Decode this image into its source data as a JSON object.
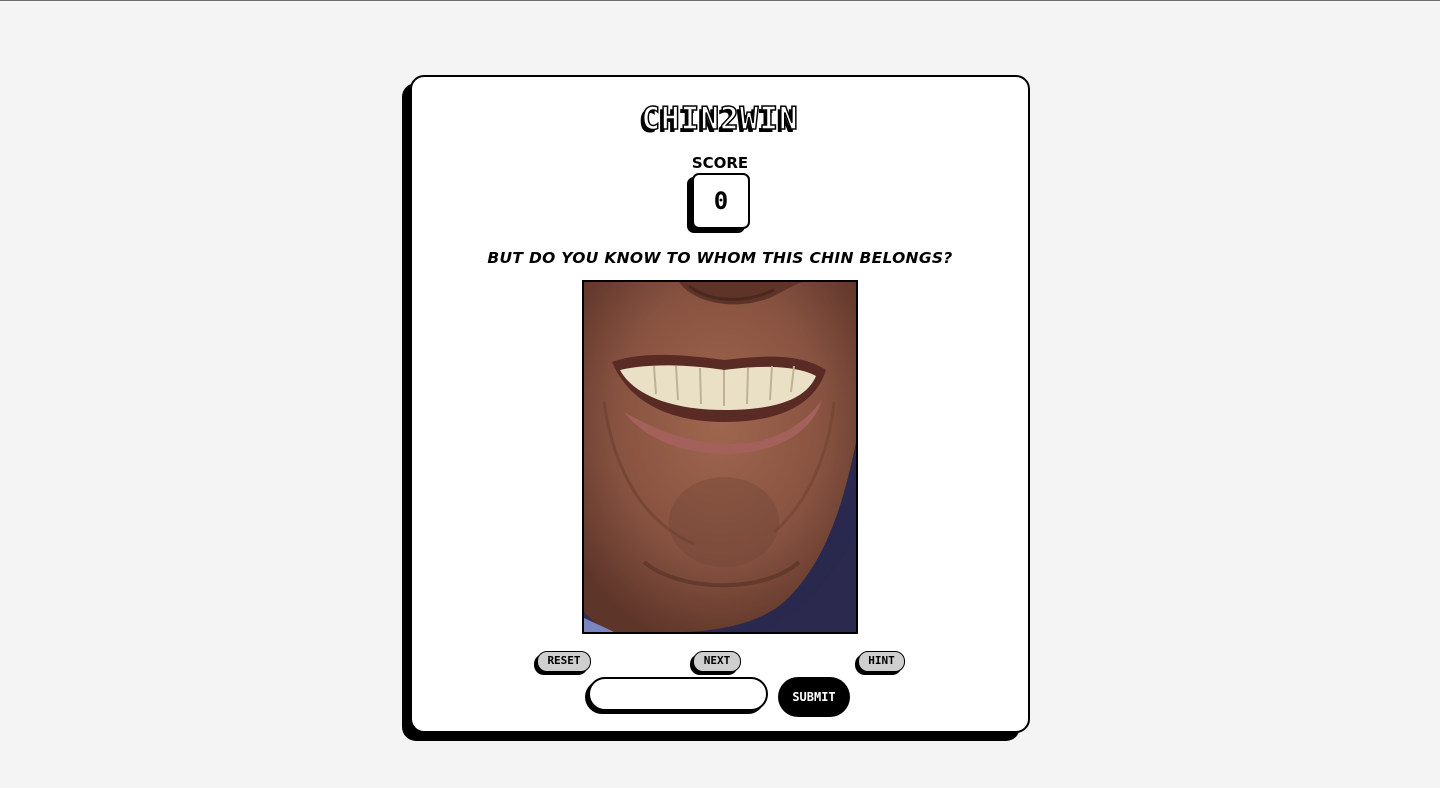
{
  "game": {
    "title": "CHIN2WIN",
    "score_label": "SCORE",
    "score_value": "0",
    "question": "BUT DO YOU KNOW TO WHOM THIS CHIN BELONGS?"
  },
  "controls": {
    "reset_label": "RESET",
    "next_label": "NEXT",
    "hint_label": "HINT",
    "answer_value": "",
    "answer_placeholder": "",
    "submit_label": "SUBMIT"
  },
  "colors": {
    "background": "#f4f4f4",
    "card": "#ffffff",
    "ink": "#000000",
    "small_button": "#cfcfcf",
    "skin": "#8a5540",
    "photo_background": "#2e2d4d"
  }
}
